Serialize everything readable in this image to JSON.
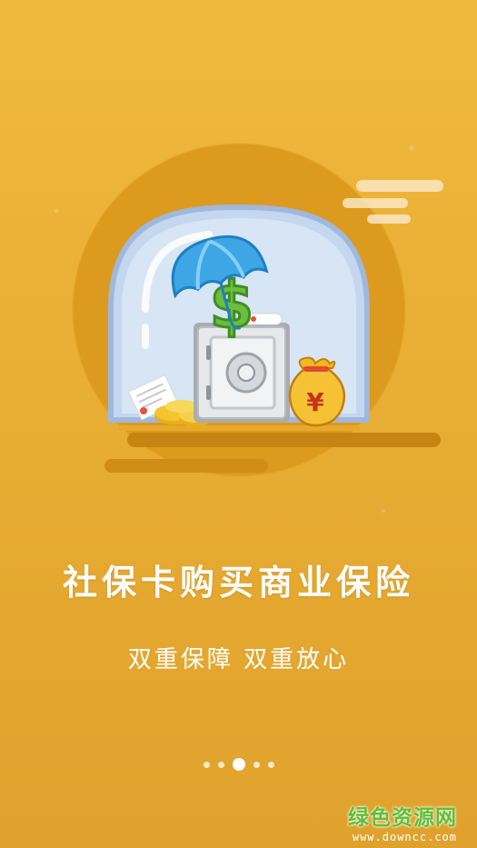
{
  "onboarding": {
    "headline": "社保卡购买商业保险",
    "subline": "双重保障  双重放心",
    "page_indicator": {
      "total": 5,
      "active_index": 2
    }
  },
  "illustration": {
    "currency_symbol": "¥",
    "dollar_symbol": "$"
  },
  "watermark": {
    "brand": "绿色资源网",
    "url": "www.downcc.com"
  },
  "colors": {
    "background": "#EDB43A",
    "circle": "#DC9A1E",
    "dome_glass": "#C5D7EE",
    "umbrella": "#3FA6E6",
    "coin_gold": "#F5C530",
    "dollar_green": "#6BBE3E",
    "watermark_green": "#5FBF3A"
  }
}
